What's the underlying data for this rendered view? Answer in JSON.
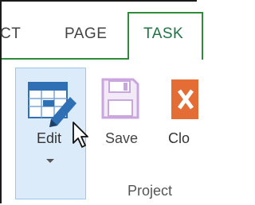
{
  "tabs": {
    "partial_label": "CT",
    "page_label": "PAGE",
    "task_label": "TASK"
  },
  "buttons": {
    "edit_label": "Edit",
    "save_label": "Save",
    "close_label": "Clo"
  },
  "group": {
    "label": "Project"
  },
  "colors": {
    "accent_green": "#2e8b3a",
    "edit_hover_bg": "#dcebfa",
    "edit_icon_blue": "#2f6fb3",
    "save_icon_purple": "#c9a6dd",
    "close_icon_orange": "#e36d35"
  },
  "icons": [
    "edit-table-icon",
    "save-disk-icon",
    "close-icon",
    "mouse-pointer-icon",
    "dropdown-arrow-icon"
  ]
}
